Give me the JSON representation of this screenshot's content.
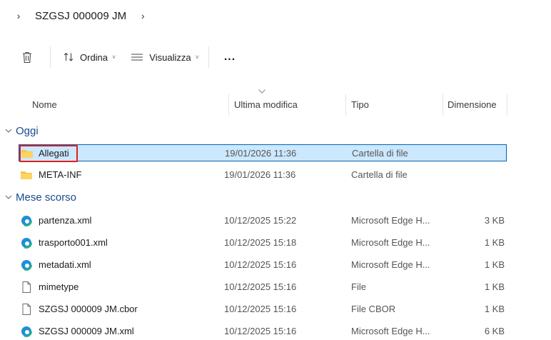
{
  "breadcrumb": {
    "items": [
      "SZGSJ 000009 JM"
    ]
  },
  "toolbar": {
    "delete_icon": "trash-icon",
    "sort_label": "Ordina",
    "view_label": "Visualizza",
    "more_label": "..."
  },
  "columns": {
    "name": "Nome",
    "modified": "Ultima modifica",
    "type": "Tipo",
    "size": "Dimensione"
  },
  "groups": [
    {
      "label": "Oggi",
      "rows": [
        {
          "name": "Allegati",
          "icon": "folder-icon",
          "modified": "19/01/2026 11:36",
          "type": "Cartella di file",
          "size": ""
        },
        {
          "name": "META-INF",
          "icon": "folder-icon",
          "modified": "19/01/2026 11:36",
          "type": "Cartella di file",
          "size": ""
        }
      ]
    },
    {
      "label": "Mese scorso",
      "rows": [
        {
          "name": "partenza.xml",
          "icon": "edge-icon",
          "modified": "10/12/2025 15:22",
          "type": "Microsoft Edge H...",
          "size": "3 KB"
        },
        {
          "name": "trasporto001.xml",
          "icon": "edge-icon",
          "modified": "10/12/2025 15:18",
          "type": "Microsoft Edge H...",
          "size": "1 KB"
        },
        {
          "name": "metadati.xml",
          "icon": "edge-icon",
          "modified": "10/12/2025 15:16",
          "type": "Microsoft Edge H...",
          "size": "1 KB"
        },
        {
          "name": "mimetype",
          "icon": "file-icon",
          "modified": "10/12/2025 15:16",
          "type": "File",
          "size": "1 KB"
        },
        {
          "name": "SZGSJ 000009 JM.cbor",
          "icon": "file-icon",
          "modified": "10/12/2025 15:16",
          "type": "File CBOR",
          "size": "1 KB"
        },
        {
          "name": "SZGSJ 000009 JM.xml",
          "icon": "edge-icon",
          "modified": "10/12/2025 15:16",
          "type": "Microsoft Edge H...",
          "size": "6 KB"
        }
      ]
    }
  ],
  "selected_row": "Allegati",
  "colors": {
    "selection_bg": "#cce8ff",
    "selection_border": "#0063b1",
    "highlight_box": "#e01e1e",
    "group_text": "#1a4a8c",
    "folder": "#f8c44a"
  }
}
